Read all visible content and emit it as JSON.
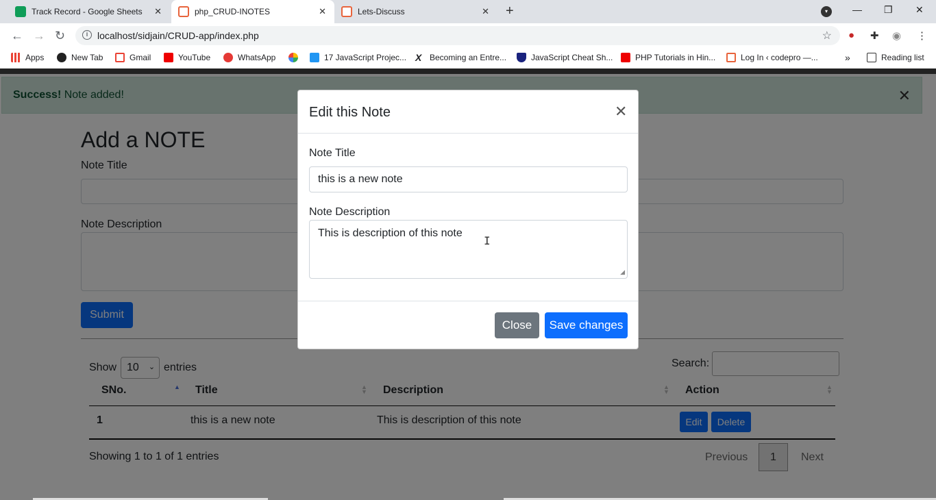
{
  "tabs": [
    {
      "title": "Track Record - Google Sheets",
      "icon": "google-sheets-icon"
    },
    {
      "title": "php_CRUD-INOTES",
      "icon": "codepen-icon"
    },
    {
      "title": "Lets-Discuss",
      "icon": "codepen-icon"
    }
  ],
  "address": {
    "url": "localhost/sidjain/CRUD-app/index.php"
  },
  "bookmarks": [
    {
      "label": "Apps",
      "icon": "apps-grid-icon"
    },
    {
      "label": "New Tab",
      "icon": "globe-icon"
    },
    {
      "label": "Gmail",
      "icon": "gmail-icon"
    },
    {
      "label": "YouTube",
      "icon": "youtube-icon"
    },
    {
      "label": "WhatsApp",
      "icon": "whatsapp-icon"
    },
    {
      "label": "",
      "icon": "pinwheel-icon"
    },
    {
      "label": "17 JavaScript Projec...",
      "icon": "m-logo-icon"
    },
    {
      "label": "Becoming an Entre...",
      "icon": "x-logo-icon"
    },
    {
      "label": "JavaScript Cheat Sh...",
      "icon": "shield-icon"
    },
    {
      "label": "PHP Tutorials in Hin...",
      "icon": "youtube-icon"
    },
    {
      "label": "Log In ‹ codepro —...",
      "icon": "codepen-icon"
    }
  ],
  "reading_list": "Reading list",
  "alert": {
    "strong": "Success!",
    "text": " Note added!"
  },
  "form": {
    "heading": "Add a NOTE",
    "title_label": "Note Title",
    "desc_label": "Note Description",
    "submit": "Submit"
  },
  "table": {
    "show_prefix": "Show",
    "show_value": "10",
    "show_suffix": "entries",
    "search_label": "Search:",
    "headers": [
      "SNo.",
      "Title",
      "Description",
      "Action"
    ],
    "rows": [
      {
        "sno": "1",
        "title": "this is a new note",
        "description": "This is description of this note",
        "edit": "Edit",
        "delete": "Delete"
      }
    ],
    "info": "Showing 1 to 1 of 1 entries",
    "pagination": {
      "previous": "Previous",
      "current": "1",
      "next": "Next"
    }
  },
  "modal": {
    "title": "Edit this Note",
    "title_label": "Note Title",
    "title_value": "this is a new note",
    "desc_label": "Note Description",
    "desc_value": "This is description of this note",
    "close": "Close",
    "save": "Save changes"
  },
  "colors": {
    "primary": "#0d6efd",
    "secondary": "#6c757d",
    "success_bg": "#d1e7dd"
  }
}
